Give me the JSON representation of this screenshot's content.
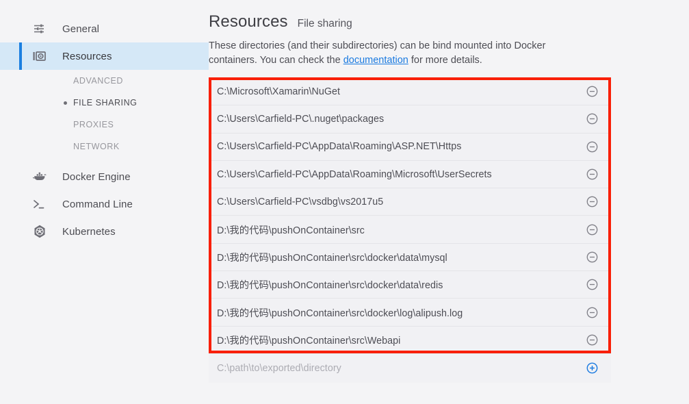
{
  "sidebar": {
    "items": [
      {
        "label": "General",
        "icon": "sliders-icon",
        "active": false
      },
      {
        "label": "Resources",
        "icon": "resources-icon",
        "active": true
      },
      {
        "label": "Docker Engine",
        "icon": "docker-whale-icon",
        "active": false
      },
      {
        "label": "Command Line",
        "icon": "terminal-icon",
        "active": false
      },
      {
        "label": "Kubernetes",
        "icon": "kubernetes-icon",
        "active": false
      }
    ],
    "subitems": [
      {
        "label": "ADVANCED",
        "active": false
      },
      {
        "label": "FILE SHARING",
        "active": true
      },
      {
        "label": "PROXIES",
        "active": false
      },
      {
        "label": "NETWORK",
        "active": false
      }
    ]
  },
  "main": {
    "title": "Resources",
    "subtitle": "File sharing",
    "description_before": "These directories (and their subdirectories) can be bind mounted into Docker containers. You can check the ",
    "description_link": "documentation",
    "description_after": " for more details.",
    "shared_paths": [
      "C:\\Microsoft\\Xamarin\\NuGet",
      "C:\\Users\\Carfield-PC\\.nuget\\packages",
      "C:\\Users\\Carfield-PC\\AppData\\Roaming\\ASP.NET\\Https",
      "C:\\Users\\Carfield-PC\\AppData\\Roaming\\Microsoft\\UserSecrets",
      "C:\\Users\\Carfield-PC\\vsdbg\\vs2017u5",
      "D:\\我的代码\\pushOnContainer\\src",
      "D:\\我的代码\\pushOnContainer\\src\\docker\\data\\mysql",
      "D:\\我的代码\\pushOnContainer\\src\\docker\\data\\redis",
      "D:\\我的代码\\pushOnContainer\\src\\docker\\log\\alipush.log",
      "D:\\我的代码\\pushOnContainer\\src\\Webapi"
    ],
    "add_placeholder": "C:\\path\\to\\exported\\directory",
    "remove_icon": "minus-circle-icon",
    "add_icon": "plus-circle-icon"
  },
  "colors": {
    "accent_blue": "#1a7ae0",
    "highlight_red": "#f91f06",
    "sidebar_active_bg": "#d5e8f7",
    "page_bg": "#f4f4f6"
  }
}
